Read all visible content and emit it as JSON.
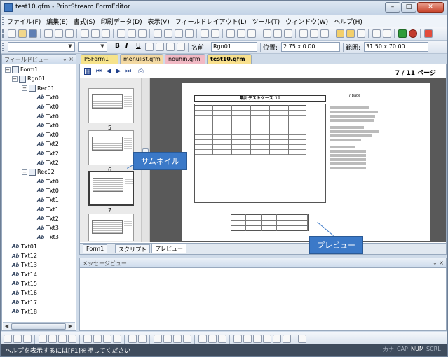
{
  "window": {
    "title": "test10.qfm - PrintStream FormEditor",
    "min": "–",
    "max": "□",
    "close": "✕"
  },
  "menu": [
    "ファイル(F)",
    "編集(E)",
    "書式(S)",
    "印刷データ(D)",
    "表示(V)",
    "フィールドレイアウト(L)",
    "ツール(T)",
    "ウィンドウ(W)",
    "ヘルプ(H)"
  ],
  "format_toolbar": {
    "font_name": "",
    "font_size": "",
    "bold": "B",
    "italic": "I",
    "underline": "U",
    "name_label": "名前:",
    "name_value": "Rgn01",
    "position_label": "位置:",
    "position_value": "2.75 x 0.00",
    "range_label": "範囲:",
    "range_value": "31.50 x 70.00"
  },
  "field_view": {
    "title": "フィールドビュー",
    "pins": "↓ ×",
    "tree": [
      {
        "label": "Form1",
        "level": 0,
        "icon": "form",
        "expander": "−"
      },
      {
        "label": "Rgn01",
        "level": 1,
        "icon": "region",
        "expander": "−"
      },
      {
        "label": "Rec01",
        "level": 2,
        "icon": "record",
        "expander": "−"
      },
      {
        "label": "Txt0",
        "level": 3,
        "icon": "text"
      },
      {
        "label": "Txt0",
        "level": 3,
        "icon": "text"
      },
      {
        "label": "Txt0",
        "level": 3,
        "icon": "text"
      },
      {
        "label": "Txt0",
        "level": 3,
        "icon": "text"
      },
      {
        "label": "Txt0",
        "level": 3,
        "icon": "text"
      },
      {
        "label": "Txt2",
        "level": 3,
        "icon": "text"
      },
      {
        "label": "Txt2",
        "level": 3,
        "icon": "text"
      },
      {
        "label": "Txt2",
        "level": 3,
        "icon": "text"
      },
      {
        "label": "Rec02",
        "level": 2,
        "icon": "record",
        "expander": "−"
      },
      {
        "label": "Txt0",
        "level": 3,
        "icon": "text"
      },
      {
        "label": "Txt0",
        "level": 3,
        "icon": "text"
      },
      {
        "label": "Txt1",
        "level": 3,
        "icon": "text"
      },
      {
        "label": "Txt1",
        "level": 3,
        "icon": "text"
      },
      {
        "label": "Txt2",
        "level": 3,
        "icon": "text"
      },
      {
        "label": "Txt3",
        "level": 3,
        "icon": "text"
      },
      {
        "label": "Txt3",
        "level": 3,
        "icon": "text"
      },
      {
        "label": "Txt01",
        "level": 1,
        "icon": "text"
      },
      {
        "label": "Txt12",
        "level": 1,
        "icon": "text"
      },
      {
        "label": "Txt13",
        "level": 1,
        "icon": "text"
      },
      {
        "label": "Txt14",
        "level": 1,
        "icon": "text"
      },
      {
        "label": "Txt15",
        "level": 1,
        "icon": "text"
      },
      {
        "label": "Txt16",
        "level": 1,
        "icon": "text"
      },
      {
        "label": "Txt17",
        "level": 1,
        "icon": "text"
      },
      {
        "label": "Txt18",
        "level": 1,
        "icon": "text"
      }
    ]
  },
  "doc_tabs": [
    {
      "label": "PSForm1",
      "color": "#f6e38b"
    },
    {
      "label": "menulist.qfm",
      "color": "#f3d9a2"
    },
    {
      "label": "nouhin.qfm",
      "color": "#f1b9c4"
    },
    {
      "label": "test10.qfm",
      "color": "#f8e08d",
      "active": true,
      "close": "×"
    }
  ],
  "preview_nav": {
    "page_info": "7 / 11 ページ"
  },
  "thumbnails": [
    {
      "num": "5"
    },
    {
      "num": "6"
    },
    {
      "num": "7"
    },
    {
      "num": ""
    }
  ],
  "report": {
    "title": "集計テストケース 10",
    "page_mark": "7 page"
  },
  "callouts": {
    "thumbnail": "サムネイル",
    "preview": "プレビュー"
  },
  "bottom_tabs": [
    "Form1",
    "スクリプト",
    "プレビュー"
  ],
  "message_view": {
    "title": "メッセージビュー",
    "pins": "↓ ×"
  },
  "status": {
    "message": "ヘルプを表示するには[F1]を押してください",
    "indicators": [
      "カナ",
      "CAP",
      "NUM",
      "SCRL"
    ]
  }
}
